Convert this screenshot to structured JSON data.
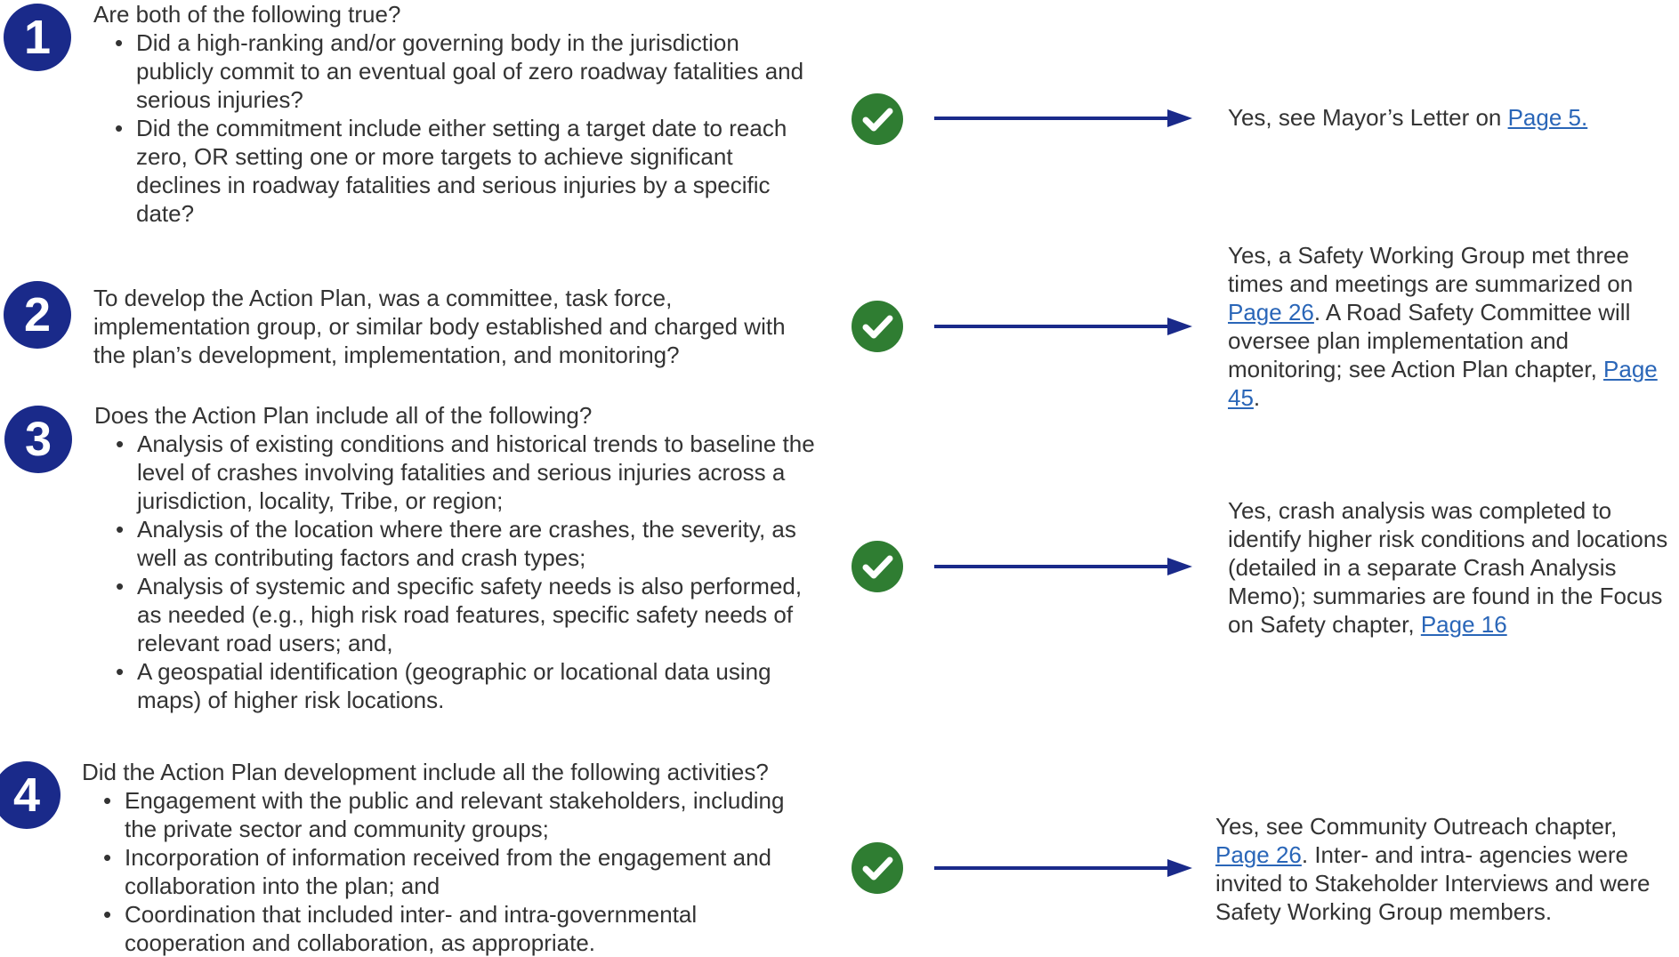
{
  "colors": {
    "badge": "#1a2a8a",
    "check": "#2f7d32",
    "arrow": "#1a2a8a",
    "link": "#2a66b8"
  },
  "icons": {
    "check": "check-circle-icon",
    "arrow": "arrow-right-icon"
  },
  "items": [
    {
      "number": "1",
      "question": "Are both of the following true?",
      "bullets": [
        "Did a high-ranking and/or governing body in the jurisdiction publicly commit to an eventual goal of zero roadway fatalities and serious injuries?",
        "Did the commitment include either setting a target date to reach zero, OR setting one or more targets to achieve significant declines in roadway fatalities and serious injuries by a specific date?"
      ],
      "answer": {
        "t1": "Yes, see Mayor’s Letter on ",
        "l1": "Page 5."
      }
    },
    {
      "number": "2",
      "question": "To develop the Action Plan, was a committee, task force, implementation group, or similar body established and charged with the plan’s development, implementation, and monitoring?",
      "bullets": [],
      "answer": {
        "t1": "Yes, a Safety Working Group met three times and meetings are summarized on ",
        "l1": "Page 26",
        "t2": ". A Road Safety Committee will oversee plan implementation and monitoring; see Action Plan chapter, ",
        "l2": "Page 45",
        "t3": "."
      }
    },
    {
      "number": "3",
      "question": "Does the Action Plan include all of the following?",
      "bullets": [
        "Analysis of existing conditions and historical trends to baseline the level of crashes involving fatalities and serious injuries across a jurisdiction, locality, Tribe, or region;",
        "Analysis of the location where there are crashes, the severity, as well as contributing factors and crash types;",
        "Analysis of systemic and specific safety needs is also performed, as needed (e.g., high risk road features, specific safety needs of relevant road users; and,",
        "A geospatial identification (geographic or locational data using maps) of higher risk locations."
      ],
      "answer": {
        "t1": "Yes, crash analysis was completed to identify higher risk conditions and locations (detailed in a separate Crash Analysis Memo); summaries are found in the Focus on Safety chapter, ",
        "l1": "Page 16"
      }
    },
    {
      "number": "4",
      "question": "Did the Action Plan development include all the following activities?",
      "bullets": [
        "Engagement with the public and relevant stakeholders, including the private sector and community groups;",
        "Incorporation of information received from the engagement and collaboration into the plan; and",
        "Coordination that included inter- and intra-governmental cooperation and collaboration, as appropriate."
      ],
      "answer": {
        "t1": "Yes, see Community Outreach chapter, ",
        "l1": "Page 26",
        "t2": ". Inter- and intra- agencies were invited to Stakeholder Interviews and were Safety Working Group members."
      }
    }
  ]
}
